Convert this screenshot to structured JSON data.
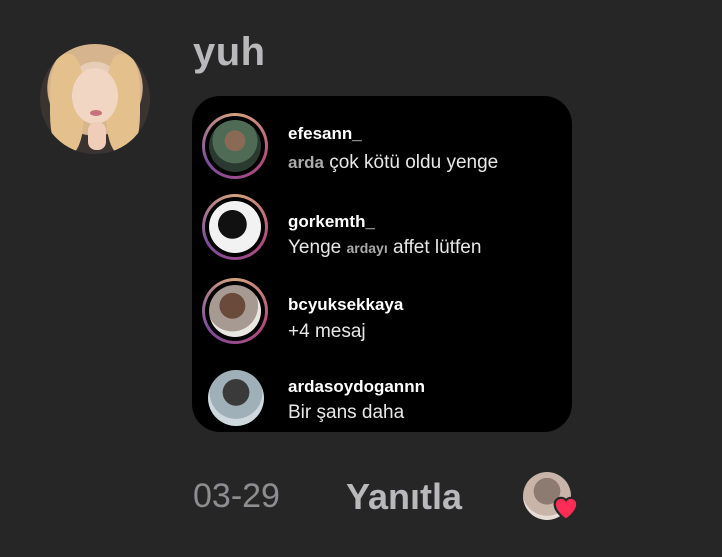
{
  "comment": {
    "author": "yuh",
    "date": "03-29",
    "reply_label": "Yanıtla"
  },
  "shared_card": {
    "items": [
      {
        "username": "efesann_",
        "mention": "arda",
        "message": " çok kötü oldu yenge"
      },
      {
        "username": "gorkemth_",
        "message_start": "Yenge ",
        "mention": "ardayı",
        "message_end": " affet lütfen"
      },
      {
        "username": "bcyuksekkaya",
        "message": "+4 mesaj"
      },
      {
        "username": "ardasoydogannn",
        "message": "Bir şans daha"
      }
    ]
  },
  "icons": {
    "author_avatar": "profile-avatar",
    "reaction": "heart-icon",
    "heart_color": "#ff2d55"
  }
}
